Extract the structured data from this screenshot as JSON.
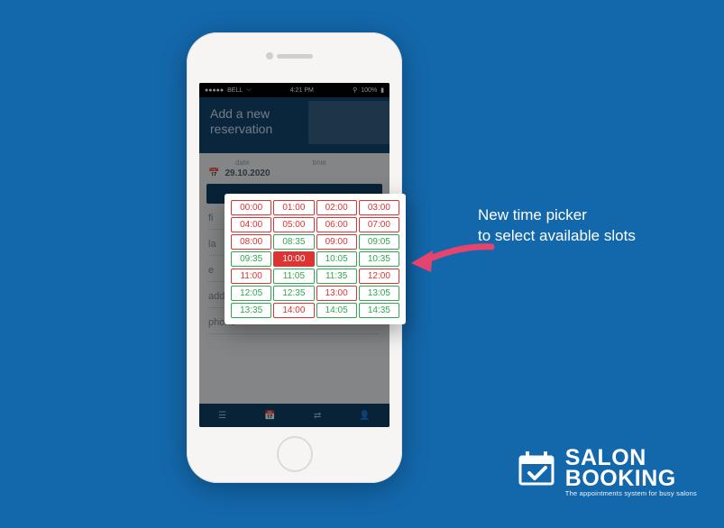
{
  "status": {
    "carrier": "BELL",
    "time": "4:21 PM",
    "battery": "100%"
  },
  "header": {
    "line1": "Add a new",
    "line2": "reservation"
  },
  "labels": {
    "date": "date",
    "time": "time"
  },
  "form": {
    "date_value": "29.10.2020",
    "fields": [
      "fi",
      "la",
      "e",
      "address",
      "phone"
    ]
  },
  "picker": {
    "rows": [
      [
        {
          "t": "00:00",
          "s": "u"
        },
        {
          "t": "01:00",
          "s": "u"
        },
        {
          "t": "02:00",
          "s": "u"
        },
        {
          "t": "03:00",
          "s": "u"
        }
      ],
      [
        {
          "t": "04:00",
          "s": "u"
        },
        {
          "t": "05:00",
          "s": "u"
        },
        {
          "t": "06:00",
          "s": "u"
        },
        {
          "t": "07:00",
          "s": "u"
        }
      ],
      [
        {
          "t": "08:00",
          "s": "u"
        },
        {
          "t": "08:35",
          "s": "a"
        },
        {
          "t": "09:00",
          "s": "u"
        },
        {
          "t": "09:05",
          "s": "a"
        }
      ],
      [
        {
          "t": "09:35",
          "s": "a"
        },
        {
          "t": "10:00",
          "s": "sel"
        },
        {
          "t": "10:05",
          "s": "a"
        },
        {
          "t": "10:35",
          "s": "a"
        }
      ],
      [
        {
          "t": "11:00",
          "s": "u"
        },
        {
          "t": "11:05",
          "s": "a"
        },
        {
          "t": "11:35",
          "s": "a"
        },
        {
          "t": "12:00",
          "s": "u"
        }
      ],
      [
        {
          "t": "12:05",
          "s": "a"
        },
        {
          "t": "12:35",
          "s": "a"
        },
        {
          "t": "13:00",
          "s": "u"
        },
        {
          "t": "13:05",
          "s": "a"
        }
      ],
      [
        {
          "t": "13:35",
          "s": "a"
        },
        {
          "t": "14:00",
          "s": "u"
        },
        {
          "t": "14:05",
          "s": "a"
        },
        {
          "t": "14:35",
          "s": "a"
        }
      ]
    ]
  },
  "callout": {
    "line1": "New time picker",
    "line2": "to select available slots"
  },
  "brand": {
    "name1": "SALON",
    "name2": "BOOKING",
    "tagline": "The appointments system for busy salons"
  },
  "bottombar": [
    "☰",
    "📅",
    "⇄",
    "👤"
  ]
}
